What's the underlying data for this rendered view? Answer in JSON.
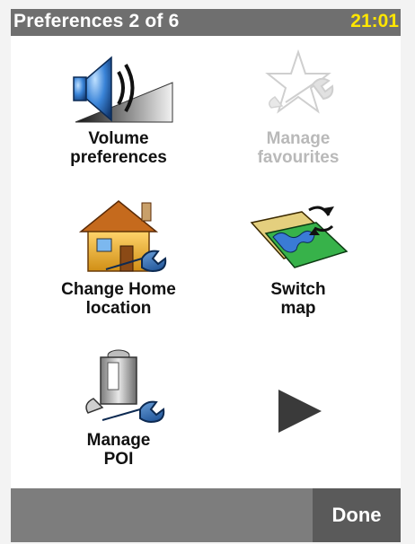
{
  "header": {
    "title": "Preferences 2 of 6",
    "clock": "21:01"
  },
  "tiles": [
    {
      "label": "Volume\npreferences",
      "icon": "speaker-icon",
      "enabled": true
    },
    {
      "label": "Manage\nfavourites",
      "icon": "favourites-wrench-icon",
      "enabled": false
    },
    {
      "label": "Change Home\nlocation",
      "icon": "home-wrench-icon",
      "enabled": true
    },
    {
      "label": "Switch\nmap",
      "icon": "map-switch-icon",
      "enabled": true
    },
    {
      "label": "Manage\nPOI",
      "icon": "poi-wrench-icon",
      "enabled": true
    }
  ],
  "next_page_icon": "play-arrow-icon",
  "footer": {
    "done_label": "Done"
  }
}
